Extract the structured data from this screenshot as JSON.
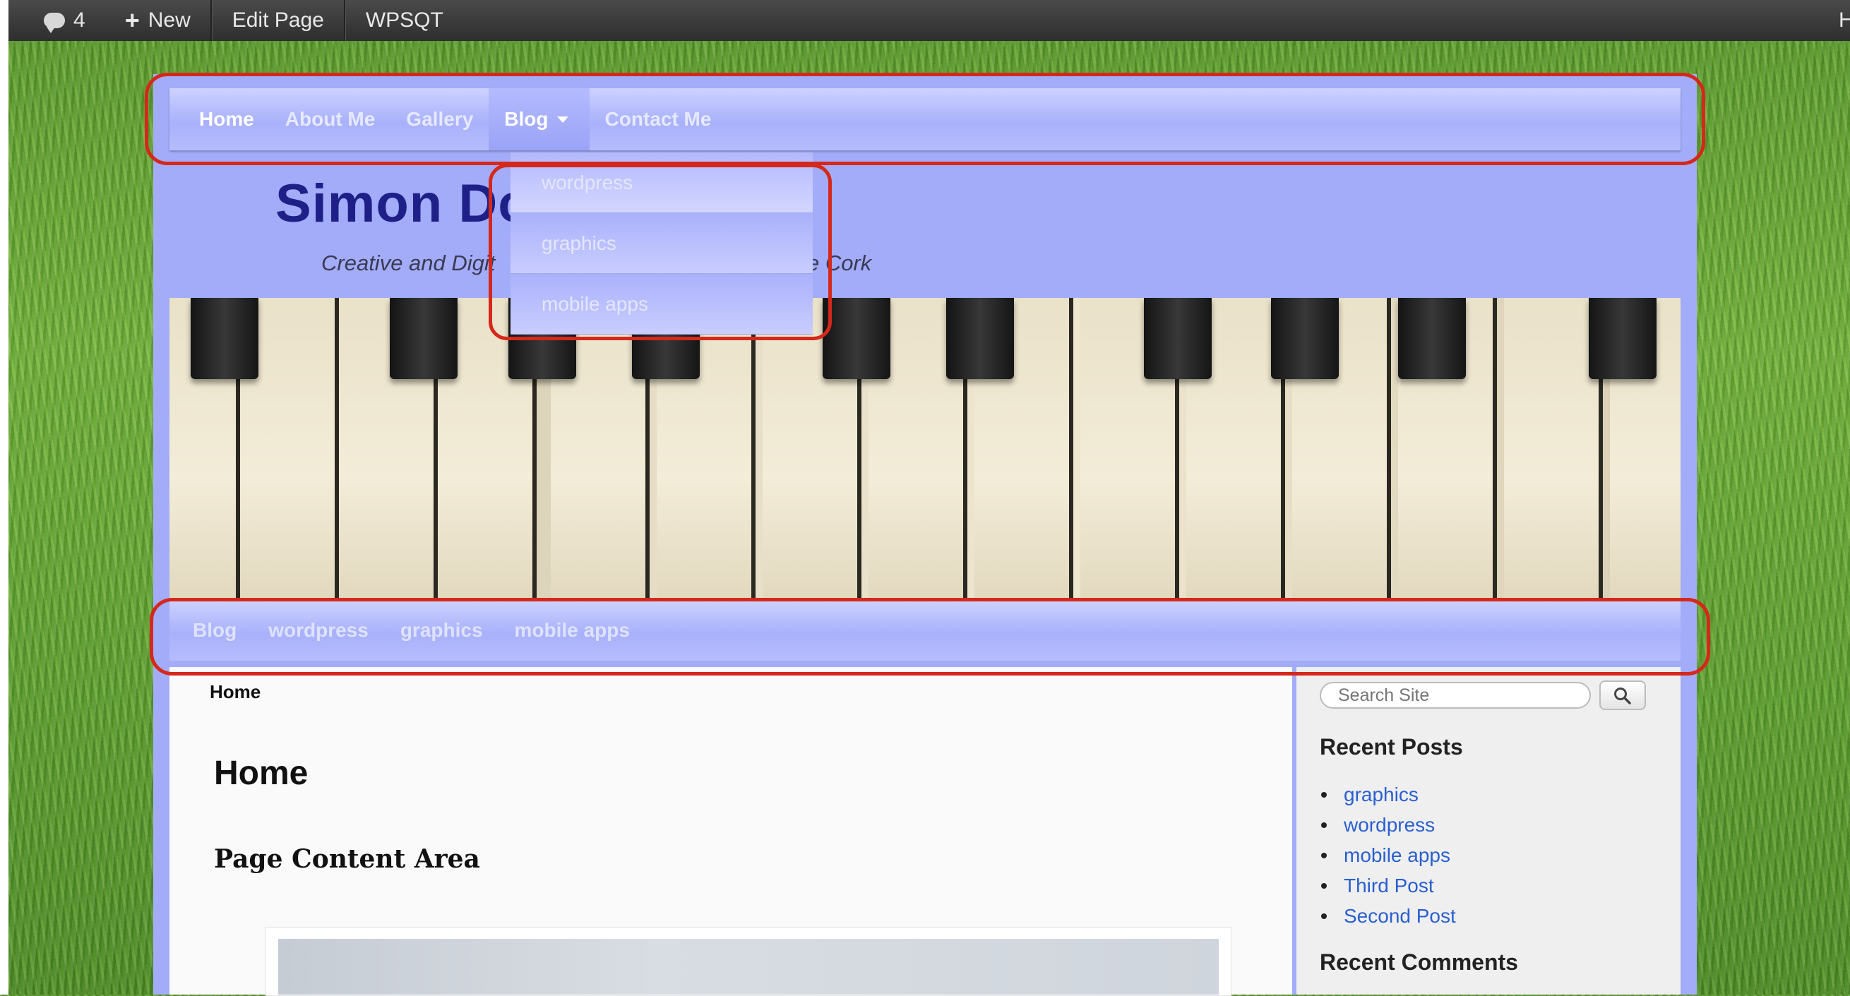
{
  "admin_bar": {
    "comments_count": "4",
    "new_label": "New",
    "edit_page_label": "Edit Page",
    "site_label": "WPSQT",
    "right_cut_text": "H"
  },
  "main_nav": {
    "items": [
      "Home",
      "About Me",
      "Gallery",
      "Blog",
      "Contact Me"
    ]
  },
  "blog_dropdown": {
    "items": [
      "wordpress",
      "graphics",
      "mobile apps"
    ]
  },
  "header": {
    "site_title": "Simon Do",
    "tagline_visible": "Creative and Digit",
    "tagline_tail": "e Cork"
  },
  "sub_nav": {
    "items": [
      "Blog",
      "wordpress",
      "graphics",
      "mobile apps"
    ]
  },
  "content": {
    "breadcrumb": "Home",
    "page_title": "Home",
    "section_heading": "Page Content Area"
  },
  "sidebar": {
    "search_placeholder": "Search Site",
    "recent_posts_heading": "Recent Posts",
    "recent_posts": [
      "graphics",
      "wordpress",
      "mobile apps",
      "Third Post",
      "Second Post"
    ],
    "recent_comments_heading": "Recent Comments"
  },
  "colors": {
    "annotation": "#d5281b",
    "nav_background": "#a9b1fb",
    "title_color": "#1e2088",
    "link_color": "#2a5fcf"
  }
}
